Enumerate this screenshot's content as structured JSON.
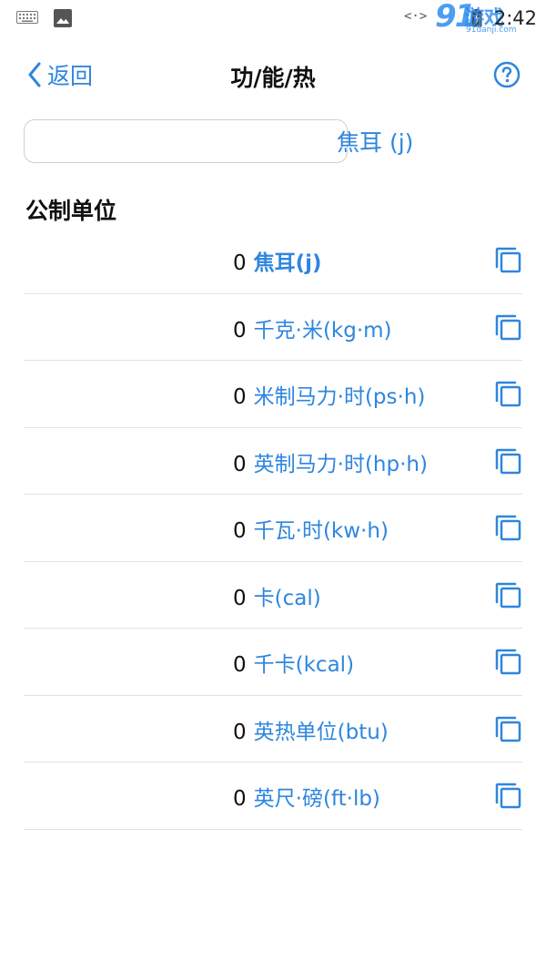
{
  "status_bar": {
    "nfc": "<·>",
    "logo_number": "91",
    "logo_text": "游戏",
    "logo_domain": "91danji.com",
    "time": "2:42"
  },
  "nav": {
    "back_label": "返回",
    "title": "功/能/热",
    "help_icon": "help-circle-icon"
  },
  "input": {
    "value": "",
    "placeholder": "",
    "unit_label": "焦耳 (j)"
  },
  "section": {
    "title": "公制单位"
  },
  "units": [
    {
      "value": "0",
      "label": "焦耳(j)",
      "selected": true
    },
    {
      "value": "0",
      "label": "千克·米(kg·m)",
      "selected": false
    },
    {
      "value": "0",
      "label": "米制马力·时(ps·h)",
      "selected": false
    },
    {
      "value": "0",
      "label": "英制马力·时(hp·h)",
      "selected": false
    },
    {
      "value": "0",
      "label": "千瓦·时(kw·h)",
      "selected": false
    },
    {
      "value": "0",
      "label": "卡(cal)",
      "selected": false
    },
    {
      "value": "0",
      "label": "千卡(kcal)",
      "selected": false
    },
    {
      "value": "0",
      "label": "英热单位(btu)",
      "selected": false
    },
    {
      "value": "0",
      "label": "英尺·磅(ft·lb)",
      "selected": false
    }
  ],
  "colors": {
    "accent": "#2e86de",
    "divider": "#e2e2e2",
    "text": "#111111"
  }
}
